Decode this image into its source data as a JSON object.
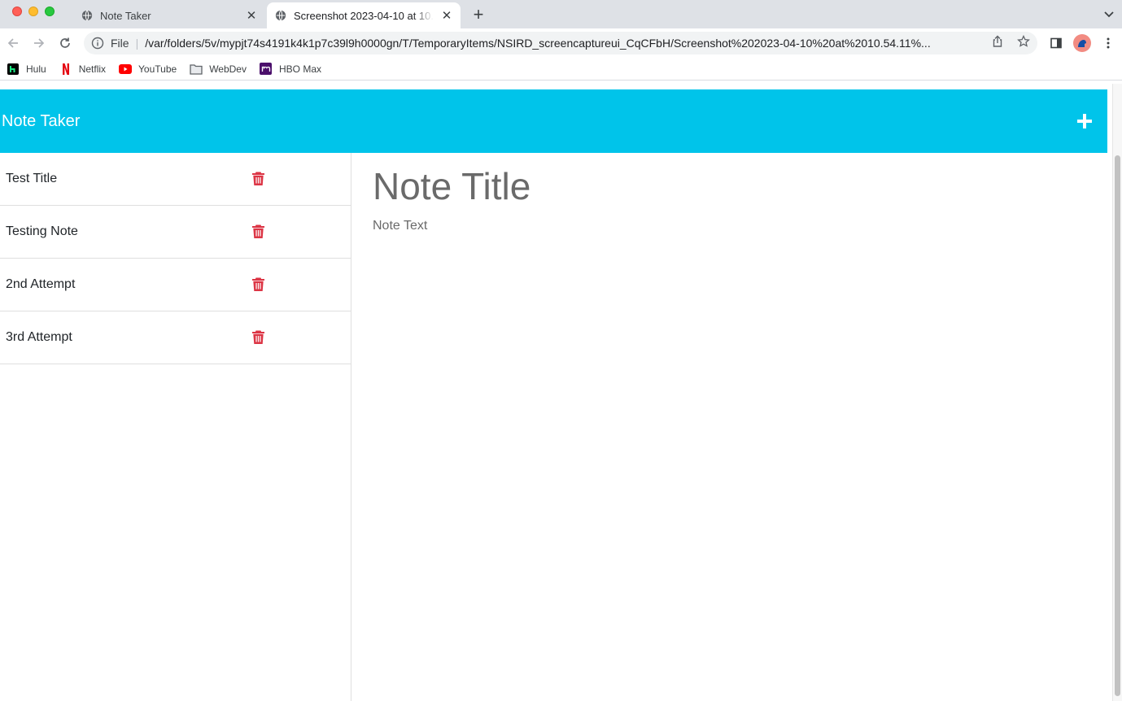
{
  "browser": {
    "tabs": [
      {
        "title": "Note Taker",
        "active": false
      },
      {
        "title": "Screenshot 2023-04-10 at 10.54.11",
        "active": true
      }
    ],
    "address": {
      "scheme": "File",
      "url": "/var/folders/5v/mypjt74s4191k4k1p7c39l9h0000gn/T/TemporaryItems/NSIRD_screencaptureui_CqCFbH/Screenshot%202023-04-10%20at%2010.54.11%..."
    },
    "bookmarks": [
      {
        "label": "Hulu",
        "icon": "hulu-icon",
        "color": "#1ce783"
      },
      {
        "label": "Netflix",
        "icon": "netflix-icon",
        "color": "#e50914"
      },
      {
        "label": "YouTube",
        "icon": "youtube-icon",
        "color": "#ff0000"
      },
      {
        "label": "WebDev",
        "icon": "folder-icon",
        "color": "#5f6368"
      },
      {
        "label": "HBO Max",
        "icon": "hbo-max-icon",
        "color": "#4b0f6b"
      }
    ]
  },
  "app": {
    "brand": "Note Taker",
    "header_color": "#00c4ea",
    "delete_color": "#dc3545",
    "notes": [
      {
        "title": "Test Title"
      },
      {
        "title": "Testing Note"
      },
      {
        "title": "2nd Attempt"
      },
      {
        "title": "3rd Attempt"
      }
    ],
    "editor": {
      "title_placeholder": "Note Title",
      "text_placeholder": "Note Text"
    }
  }
}
